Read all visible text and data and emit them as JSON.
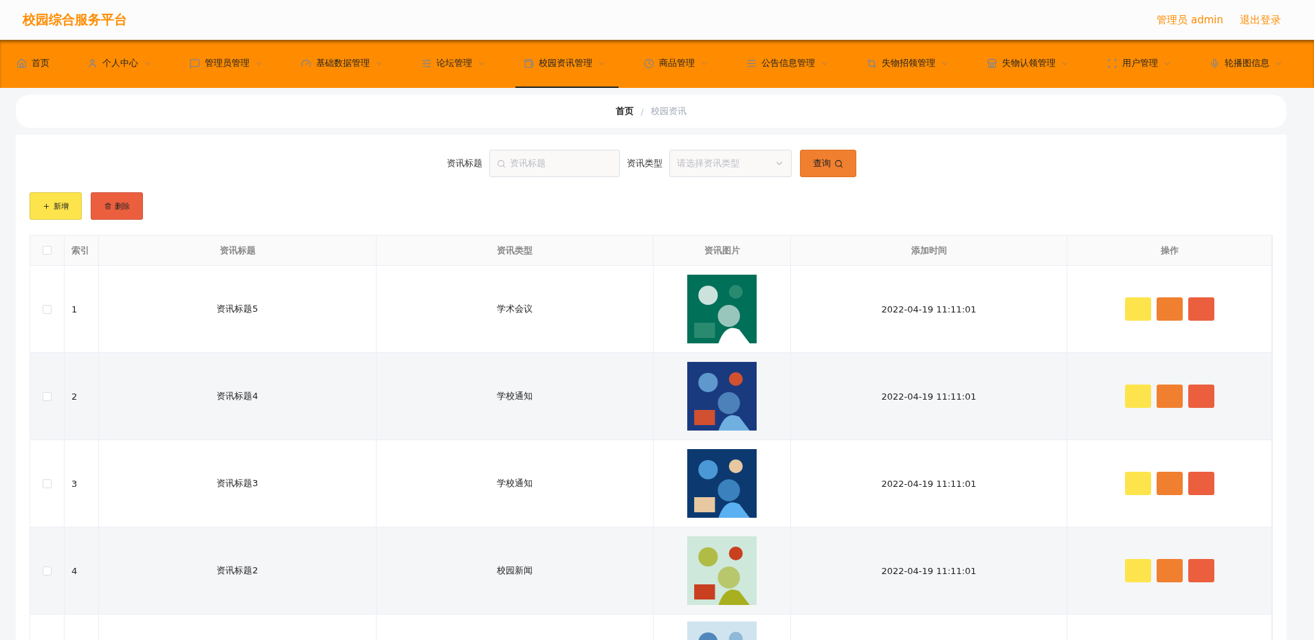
{
  "header": {
    "title": "校园综合服务平台",
    "user": "管理员 admin",
    "logout": "退出登录"
  },
  "nav": [
    {
      "label": "首页",
      "selected": false,
      "has_menu": false
    },
    {
      "label": "个人中心",
      "selected": false,
      "has_menu": true
    },
    {
      "label": "管理员管理",
      "selected": false,
      "has_menu": true
    },
    {
      "label": "基础数据管理",
      "selected": false,
      "has_menu": true
    },
    {
      "label": "论坛管理",
      "selected": false,
      "has_menu": true
    },
    {
      "label": "校园资讯管理",
      "selected": true,
      "has_menu": true
    },
    {
      "label": "商品管理",
      "selected": false,
      "has_menu": true
    },
    {
      "label": "公告信息管理",
      "selected": false,
      "has_menu": true
    },
    {
      "label": "失物招领管理",
      "selected": false,
      "has_menu": true
    },
    {
      "label": "失物认领管理",
      "selected": false,
      "has_menu": true
    },
    {
      "label": "用户管理",
      "selected": false,
      "has_menu": true
    },
    {
      "label": "轮播图信息",
      "selected": false,
      "has_menu": true
    }
  ],
  "breadcrumb": {
    "separator": "/",
    "items": [
      "首页",
      "校园资讯"
    ]
  },
  "search": {
    "title_label": "资讯标题",
    "title_placeholder": "资讯标题",
    "type_label": "资讯类型",
    "type_placeholder": "请选择资讯类型",
    "query_button": "查询"
  },
  "actions": {
    "add": "新增",
    "delete": "删除"
  },
  "table": {
    "select_all_checked": false,
    "columns": [
      "索引",
      "资讯标题",
      "资讯类型",
      "资讯图片",
      "添加时间",
      "操作"
    ],
    "rows": [
      {
        "checked": false,
        "index": "1",
        "title": "资讯标题5",
        "type": "学术会议",
        "image": {
          "kind": "picture"
        },
        "time": "2022-04-19 11:11:01"
      },
      {
        "checked": false,
        "index": "2",
        "title": "资讯标题4",
        "type": "学校通知",
        "image": {
          "kind": "picture"
        },
        "time": "2022-04-19 11:11:01"
      },
      {
        "checked": false,
        "index": "3",
        "title": "资讯标题3",
        "type": "学校通知",
        "image": {
          "kind": "picture"
        },
        "time": "2022-04-19 11:11:01"
      },
      {
        "checked": false,
        "index": "4",
        "title": "资讯标题2",
        "type": "校园新闻",
        "image": {
          "kind": "picture"
        },
        "time": "2022-04-19 11:11:01"
      },
      {
        "image": {
          "kind": "picture"
        }
      }
    ]
  }
}
